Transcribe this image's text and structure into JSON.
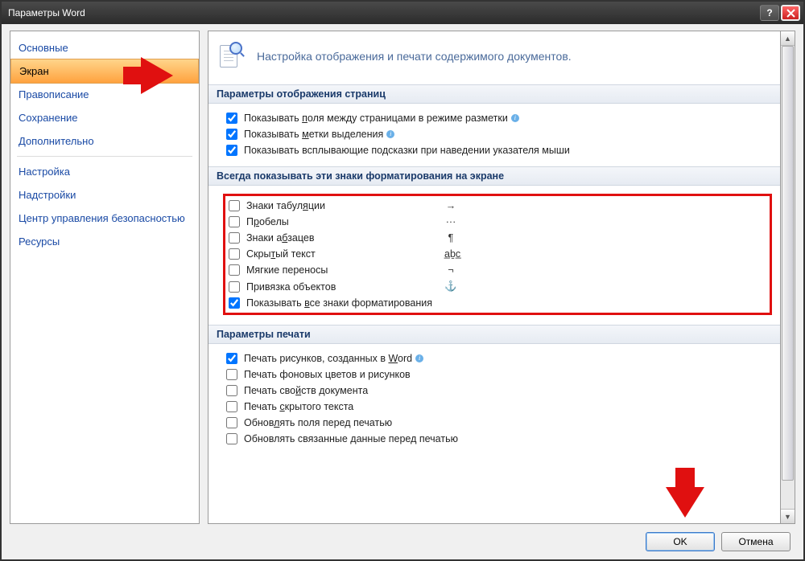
{
  "window": {
    "title": "Параметры Word"
  },
  "sidebar": {
    "items": [
      {
        "label": "Основные",
        "active": false
      },
      {
        "label": "Экран",
        "active": true
      },
      {
        "label": "Правописание",
        "active": false
      },
      {
        "label": "Сохранение",
        "active": false
      },
      {
        "label": "Дополнительно",
        "active": false
      }
    ],
    "items2": [
      {
        "label": "Настройка",
        "active": false
      },
      {
        "label": "Надстройки",
        "active": false
      },
      {
        "label": "Центр управления безопасностью",
        "active": false
      },
      {
        "label": "Ресурсы",
        "active": false
      }
    ]
  },
  "heading": "Настройка отображения и печати содержимого документов.",
  "sections": {
    "display": {
      "title": "Параметры отображения страниц",
      "items": [
        {
          "label_pre": "Показывать ",
          "ul": "п",
          "label_post": "оля между страницами в режиме разметки",
          "checked": true,
          "info": true
        },
        {
          "label_pre": "Показывать ",
          "ul": "м",
          "label_post": "етки выделения",
          "checked": true,
          "info": true
        },
        {
          "label_pre": "Показывать всплывающие подсказки при наведении указателя мыши",
          "ul": "",
          "label_post": "",
          "checked": true,
          "info": false
        }
      ]
    },
    "marks": {
      "title": "Всегда показывать эти знаки форматирования на экране",
      "items": [
        {
          "label_pre": "Знаки табул",
          "ul": "я",
          "label_post": "ции",
          "checked": false,
          "sym": "→"
        },
        {
          "label_pre": "П",
          "ul": "р",
          "label_post": "обелы",
          "checked": false,
          "sym": "···"
        },
        {
          "label_pre": "Знаки а",
          "ul": "б",
          "label_post": "зацев",
          "checked": false,
          "sym": "¶"
        },
        {
          "label_pre": "Скры",
          "ul": "т",
          "label_post": "ый текст",
          "checked": false,
          "sym": "a̲ḇc̲"
        },
        {
          "label_pre": "Мягкие переносы",
          "ul": "",
          "label_post": "",
          "checked": false,
          "sym": "¬"
        },
        {
          "label_pre": "Привязка объектов",
          "ul": "",
          "label_post": "",
          "checked": false,
          "sym": "⚓"
        },
        {
          "label_pre": "Показывать ",
          "ul": "в",
          "label_post": "се знаки форматирования",
          "checked": true,
          "sym": ""
        }
      ]
    },
    "print": {
      "title": "Параметры печати",
      "items": [
        {
          "label_pre": "Печать рисунков, созданных в ",
          "ul": "W",
          "label_post": "ord",
          "checked": true,
          "info": true
        },
        {
          "label_pre": "Печать фоновых цветов и рисунков",
          "ul": "",
          "label_post": "",
          "checked": false,
          "info": false
        },
        {
          "label_pre": "Печать сво",
          "ul": "й",
          "label_post": "ств документа",
          "checked": false,
          "info": false
        },
        {
          "label_pre": "Печать ",
          "ul": "с",
          "label_post": "крытого текста",
          "checked": false,
          "info": false
        },
        {
          "label_pre": "Обнов",
          "ul": "л",
          "label_post": "ять поля перед печатью",
          "checked": false,
          "info": false
        },
        {
          "label_pre": "Обновлять связанные данные перед печатью",
          "ul": "",
          "label_post": "",
          "checked": false,
          "info": false
        }
      ]
    }
  },
  "buttons": {
    "ok": "OK",
    "cancel": "Отмена"
  }
}
